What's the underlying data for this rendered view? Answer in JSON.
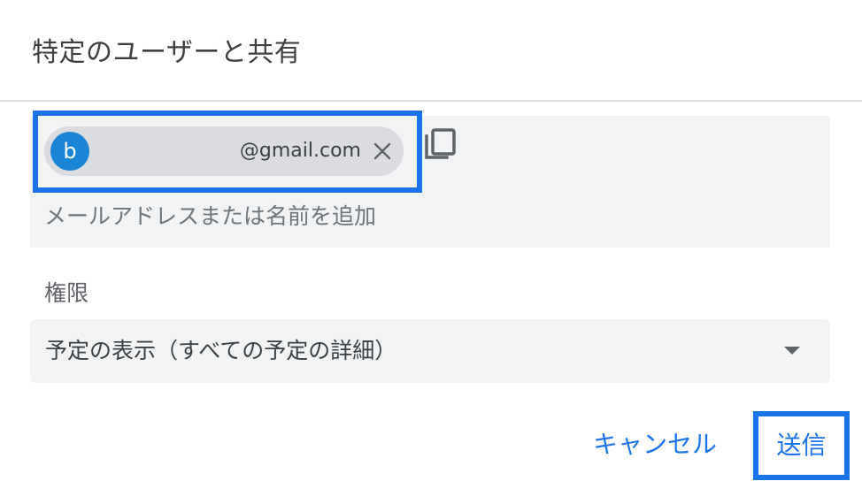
{
  "dialog": {
    "title": "特定のユーザーと共有"
  },
  "recipients": {
    "chips": [
      {
        "avatar_letter": "b",
        "email": "@gmail.com",
        "remove_icon": "close-icon"
      }
    ],
    "copy_icon": "copy-icon",
    "input_placeholder": "メールアドレスまたは名前を追加",
    "input_value": ""
  },
  "permissions": {
    "label": "権限",
    "selected": "予定の表示（すべての予定の詳細）",
    "arrow_icon": "dropdown-arrow-icon"
  },
  "actions": {
    "cancel_label": "キャンセル",
    "send_label": "送信"
  },
  "colors": {
    "accent": "#1a73e8",
    "avatar": "#1a84d6",
    "field_background": "#f1f3f4",
    "chip_background": "#dadce0"
  }
}
